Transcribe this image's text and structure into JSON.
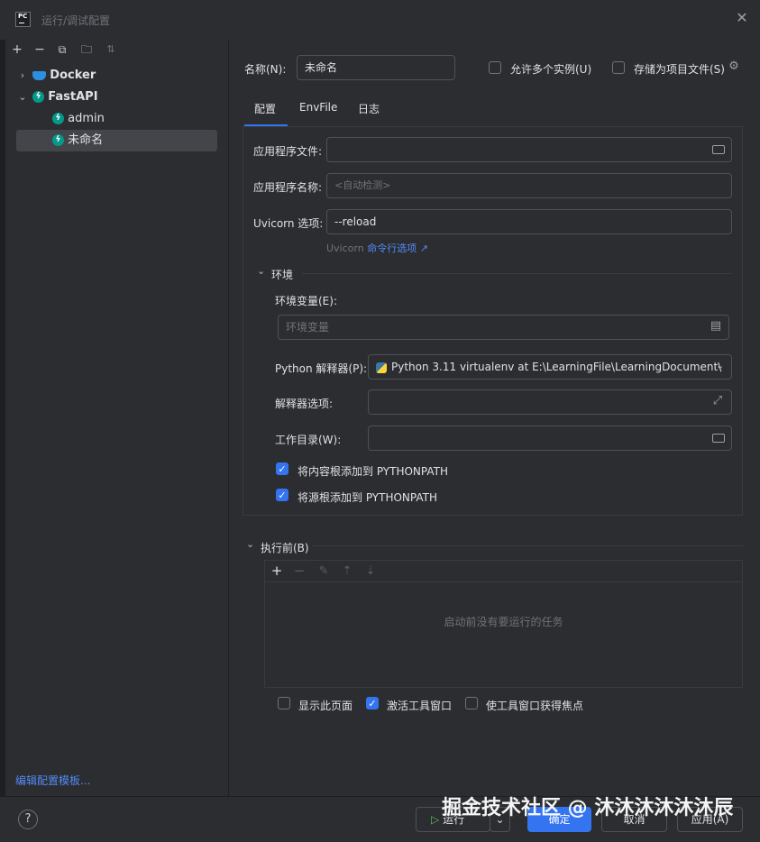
{
  "window": {
    "title": "运行/调试配置",
    "app_icon": "PC"
  },
  "left": {
    "toolbar": [
      "add-icon",
      "remove-icon",
      "copy-icon",
      "new-folder-icon",
      "sort-icon"
    ],
    "tree": {
      "docker": "Docker",
      "fastapi": "FastAPI",
      "admin": "admin",
      "unnamed": "未命名"
    },
    "edit_templates": "编辑配置模板..."
  },
  "header": {
    "name_label": "名称(N):",
    "name_value": "未命名",
    "allow_multiple": "允许多个实例(U)",
    "store_as_project": "存储为项目文件(S)"
  },
  "tabs": [
    "配置",
    "EnvFile",
    "日志"
  ],
  "config": {
    "app_file_label": "应用程序文件:",
    "app_name_label": "应用程序名称:",
    "app_name_placeholder": "<自动检测>",
    "uvicorn_label": "Uvicorn 选项:",
    "uvicorn_value": "--reload",
    "uvicorn_hint_prefix": "Uvicorn",
    "uvicorn_hint_link": "命令行选项 ↗",
    "env_section": "环境",
    "env_vars_label": "环境变量(E):",
    "env_vars_placeholder": "环境变量",
    "interpreter_label": "Python 解释器(P):",
    "interpreter_value": "Python 3.11 virtualenv at E:\\LearningFile\\LearningDocument\\",
    "interp_options_label": "解释器选项:",
    "workdir_label": "工作目录(W):",
    "add_content_roots": "将内容根添加到 PYTHONPATH",
    "add_source_roots": "将源根添加到 PYTHONPATH"
  },
  "before_launch": {
    "title": "执行前(B)",
    "empty": "启动前没有要运行的任务",
    "show_page": "显示此页面",
    "activate_tool": "激活工具窗口",
    "focus_tool": "使工具窗口获得焦点"
  },
  "buttons": {
    "run": "运行",
    "ok": "确定",
    "cancel": "取消",
    "apply": "应用(A)",
    "help": "?"
  },
  "watermark": "掘金技术社区 @ 沐沐沐沐沐沐辰"
}
